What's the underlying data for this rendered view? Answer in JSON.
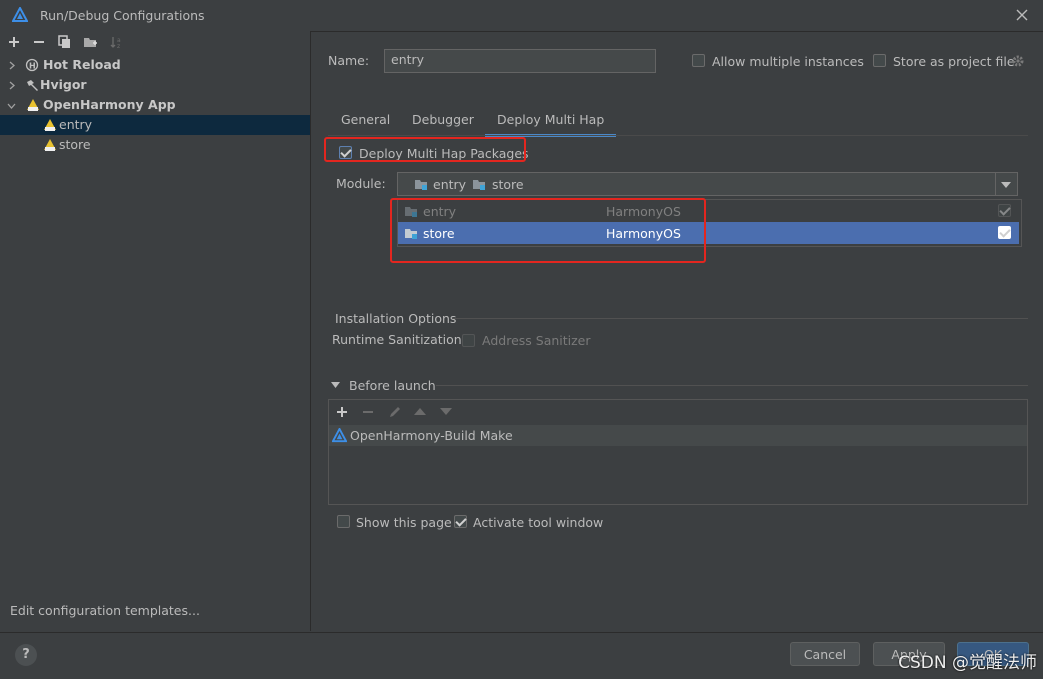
{
  "window": {
    "title": "Run/Debug Configurations"
  },
  "tree": {
    "items": [
      {
        "label": "Hot Reload"
      },
      {
        "label": "Hvigor"
      },
      {
        "label": "OpenHarmony App"
      },
      {
        "label": "entry"
      },
      {
        "label": "store"
      }
    ],
    "edit_templates_link": "Edit configuration templates..."
  },
  "form": {
    "name_label": "Name:",
    "name_value": "entry",
    "allow_multiple_label": "Allow multiple instances",
    "store_as_project_label": "Store as project file"
  },
  "tabs": [
    {
      "label": "General"
    },
    {
      "label": "Debugger"
    },
    {
      "label": "Deploy Multi Hap"
    }
  ],
  "deploy": {
    "checkbox_label": "Deploy Multi Hap Packages",
    "module_label": "Module:",
    "module_selected": [
      "entry",
      "store"
    ],
    "modules": [
      {
        "name": "entry",
        "os": "HarmonyOS"
      },
      {
        "name": "store",
        "os": "HarmonyOS"
      }
    ]
  },
  "installation": {
    "header": "Installation Options",
    "runtime_label": "Runtime Sanitization",
    "address_sanitizer_label": "Address Sanitizer"
  },
  "before_launch": {
    "header": "Before launch",
    "tasks": [
      {
        "label": "OpenHarmony-Build Make"
      }
    ]
  },
  "footer": {
    "show_page_label": "Show this page",
    "activate_tool_label": "Activate tool window",
    "help_label": "?",
    "cancel_label": "Cancel",
    "apply_label": "Apply",
    "ok_label": "OK"
  },
  "watermark": "CSDN @觉醒法师",
  "colors": {
    "accent": "#4a88c7",
    "selection_row": "#4b6eaf",
    "highlight_box": "#e3261f",
    "background": "#3c3f41"
  },
  "icons": {
    "app": "harmony-logo-icon",
    "close": "close-icon",
    "module": "folder-module-icon",
    "config": "openharmony-config-icon"
  }
}
